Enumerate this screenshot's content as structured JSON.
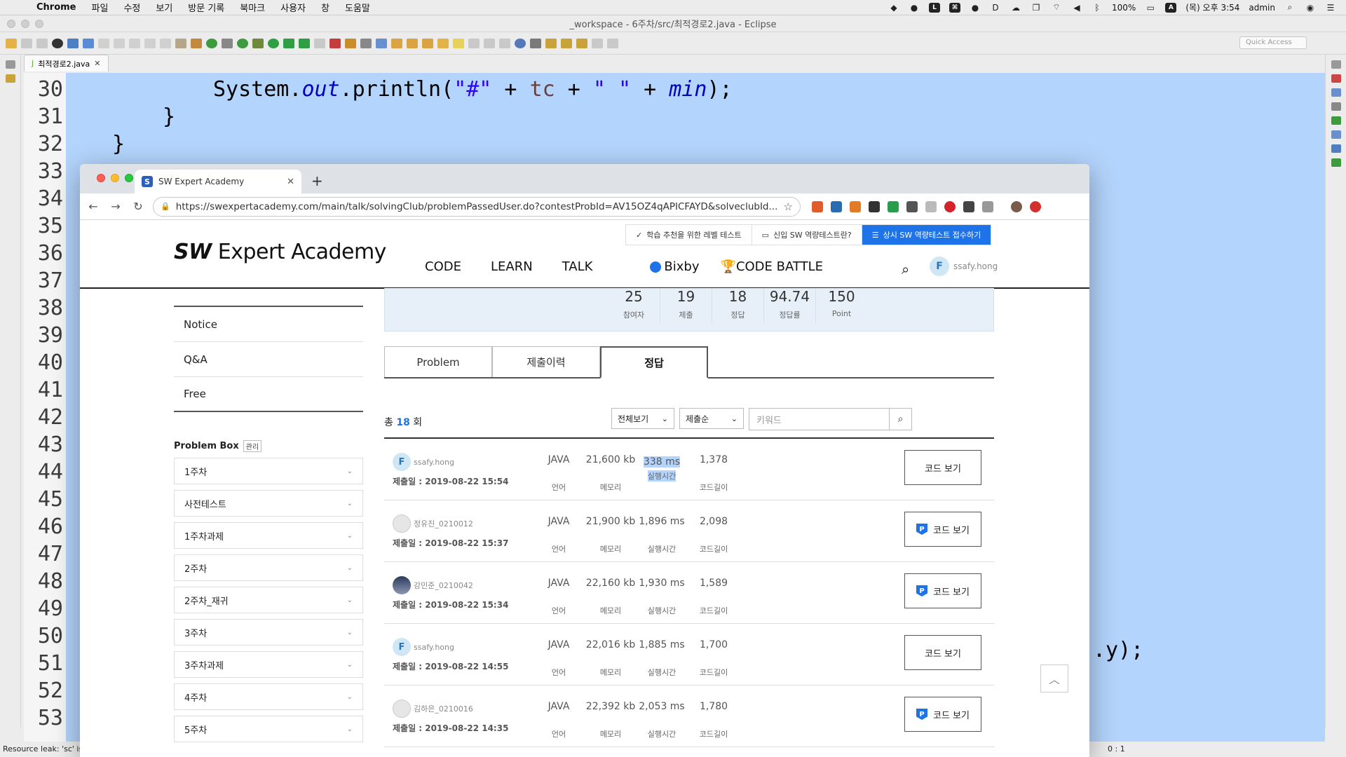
{
  "menubar": {
    "app_name": "Chrome",
    "items": [
      "파일",
      "수정",
      "보기",
      "방문 기록",
      "북마크",
      "사용자",
      "창",
      "도움말"
    ],
    "battery": "100%",
    "input_mode": "A",
    "clock": "(목) 오후 3:54",
    "user": "admin"
  },
  "eclipse": {
    "window_title": "_workspace - 6주차/src/최적경로2.java - Eclipse",
    "quick_access_placeholder": "Quick Access",
    "editor_tab": "최적경로2.java",
    "line_numbers": [
      "30",
      "31",
      "32",
      "33",
      "34",
      "35",
      "36",
      "37",
      "38",
      "39",
      "40",
      "41",
      "42",
      "43",
      "44",
      "45",
      "46",
      "47",
      "48",
      "49",
      "50",
      "51",
      "52",
      "53"
    ],
    "code": {
      "line30_a": "System.",
      "line30_out": "out",
      "line30_b": ".println(",
      "line30_s1": "\"#\"",
      "line30_c": " + ",
      "line30_tc": "tc",
      "line30_d": " + ",
      "line30_s2": "\" \"",
      "line30_e": " + ",
      "line30_min": "min",
      "line30_f": ");",
      "line31": "}",
      "line32": "}",
      "line50_tail": ".y);"
    },
    "status_text": "Resource leak: 'sc' is never closed",
    "status_right": "0 : 1"
  },
  "chrome": {
    "tab_title": "SW Expert Academy",
    "favicon_letter": "S",
    "url": "https://swexpertacademy.com/main/talk/solvingClub/problemPassedUser.do?contestProbId=AV15OZ4qAPICFAYD&solveclubId..."
  },
  "site": {
    "util": {
      "level_test": "학습 추천을 위한 레벨 테스트",
      "what_is": "신입 SW 역량테스트란?",
      "apply": "상시 SW 역량테스트 접수하기"
    },
    "logo_sw": "SW",
    "logo_rest": " Expert Academy",
    "nav": [
      "CODE",
      "LEARN",
      "TALK"
    ],
    "nav_bixby": "Bixby",
    "nav_battle": "CODE BATTLE",
    "username": "ssafy.hong",
    "avatar_letter": "F",
    "sidebar_links": [
      "Notice",
      "Q&A",
      "Free"
    ],
    "problem_box_title": "Problem Box",
    "problem_box_manage": "관리",
    "problem_box_items": [
      "1주차",
      "사전테스트",
      "1주차과제",
      "2주차",
      "2주차_재귀",
      "3주차",
      "3주차과제",
      "4주차",
      "5주차"
    ],
    "stats": [
      {
        "num": "25",
        "label": "참여자"
      },
      {
        "num": "19",
        "label": "제출"
      },
      {
        "num": "18",
        "label": "정답"
      },
      {
        "num": "94.74",
        "label": "정답률"
      },
      {
        "num": "150",
        "label": "Point"
      }
    ],
    "tabs": [
      "Problem",
      "제출이력",
      "정답"
    ],
    "active_tab": "정답",
    "total_prefix": "총",
    "total_count": "18",
    "total_suffix": "회",
    "filter_view": "전체보기",
    "filter_sort": "제출순",
    "keyword_placeholder": "키워드",
    "date_prefix": "제출일 : ",
    "labels": {
      "lang": "언어",
      "mem": "메모리",
      "time": "실행시간",
      "len": "코드길이"
    },
    "code_view_label": "코드 보기",
    "rows": [
      {
        "user": "ssafy.hong",
        "date": "2019-08-22 15:54",
        "lang": "JAVA",
        "mem": "21,600 kb",
        "time": "338 ms",
        "len": "1,378",
        "premium": false
      },
      {
        "user": "정유진_0210012",
        "date": "2019-08-22 15:37",
        "lang": "JAVA",
        "mem": "21,900 kb",
        "time": "1,896 ms",
        "len": "2,098",
        "premium": true
      },
      {
        "user": "강민준_0210042",
        "date": "2019-08-22 15:34",
        "lang": "JAVA",
        "mem": "22,160 kb",
        "time": "1,930 ms",
        "len": "1,589",
        "premium": true
      },
      {
        "user": "ssafy.hong",
        "date": "2019-08-22 14:55",
        "lang": "JAVA",
        "mem": "22,016 kb",
        "time": "1,885 ms",
        "len": "1,700",
        "premium": false
      },
      {
        "user": "김하은_0210016",
        "date": "2019-08-22 14:35",
        "lang": "JAVA",
        "mem": "22,392 kb",
        "time": "2,053 ms",
        "len": "1,780",
        "premium": true
      }
    ]
  }
}
